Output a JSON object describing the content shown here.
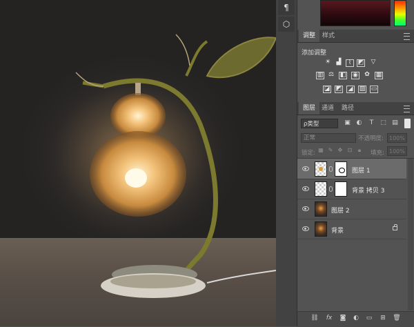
{
  "panels": {
    "adjustments_tab": "调整",
    "styles_tab": "样式",
    "add_adjustment": "添加调整",
    "layers_tab": "图层",
    "channels_tab": "通道",
    "paths_tab": "路径"
  },
  "layers_panel": {
    "filter_kind": "ρ类型",
    "blend_mode": "正常",
    "opacity_label": "不透明度:",
    "opacity_value": "100%",
    "lock_label": "锁定:",
    "fill_label": "填充:",
    "fill_value": "100%",
    "layers": [
      {
        "name": "图层 1",
        "thumb": "checker",
        "mask": true,
        "selected": true
      },
      {
        "name": "背景 拷贝 3",
        "thumb": "checker",
        "mask": true,
        "selected": false
      },
      {
        "name": "图层 2",
        "thumb": "photo",
        "mask": false,
        "selected": false
      },
      {
        "name": "背景",
        "thumb": "photo",
        "mask": false,
        "locked": true,
        "selected": false
      }
    ]
  },
  "icons": {
    "strip": [
      "paragraph-icon",
      "3d-cube-icon"
    ],
    "adjustments_row1": [
      "brightness-icon",
      "levels-icon",
      "curves-icon",
      "exposure-icon",
      "gradient-map-triangle-icon"
    ],
    "adjustments_row2": [
      "vibrance-icon",
      "color-balance-icon",
      "black-white-icon",
      "photo-filter-icon",
      "channel-mixer-icon",
      "color-lookup-icon"
    ],
    "adjustments_row3": [
      "invert-icon",
      "posterize-icon",
      "threshold-icon",
      "selective-color-icon",
      "gradient-map-icon"
    ],
    "footer": [
      "link-layers-icon",
      "fx-icon",
      "add-mask-icon",
      "adjustment-layer-icon",
      "group-folder-icon",
      "new-layer-icon",
      "trash-icon"
    ]
  },
  "colors": {
    "panel_bg": "#535353",
    "selected_layer": "#6b6b6b",
    "foreground_swatch": "#5a1820"
  }
}
